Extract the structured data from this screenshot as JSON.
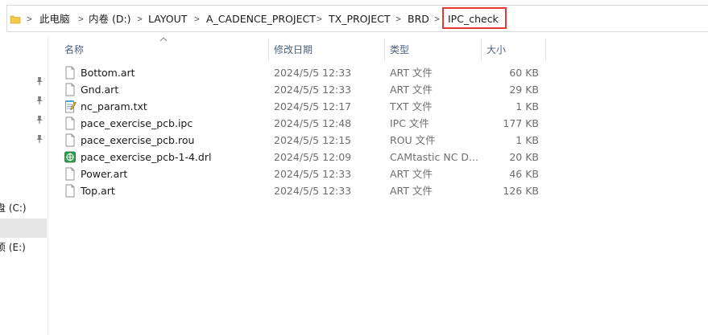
{
  "breadcrumb": [
    "此电脑",
    "内卷 (D:)",
    "LAYOUT",
    "A_CADENCE_PROJECT",
    "TX_PROJECT",
    "BRD",
    "IPC_check"
  ],
  "columns": {
    "name": "名称",
    "modified": "修改日期",
    "type": "类型",
    "size": "大小"
  },
  "files": [
    {
      "name": "Bottom.art",
      "modified": "2024/5/5 12:33",
      "type": "ART 文件",
      "size": "60 KB",
      "icon": "blank-file-icon"
    },
    {
      "name": "Gnd.art",
      "modified": "2024/5/5 12:33",
      "type": "ART 文件",
      "size": "29 KB",
      "icon": "blank-file-icon"
    },
    {
      "name": "nc_param.txt",
      "modified": "2024/5/5 12:17",
      "type": "TXT 文件",
      "size": "1 KB",
      "icon": "notepad-file-icon"
    },
    {
      "name": "pace_exercise_pcb.ipc",
      "modified": "2024/5/5 12:48",
      "type": "IPC 文件",
      "size": "177 KB",
      "icon": "blank-file-icon"
    },
    {
      "name": "pace_exercise_pcb.rou",
      "modified": "2024/5/5 12:15",
      "type": "ROU 文件",
      "size": "1 KB",
      "icon": "blank-file-icon"
    },
    {
      "name": "pace_exercise_pcb-1-4.drl",
      "modified": "2024/5/5 12:09",
      "type": "CAMtastic NC D...",
      "size": "20 KB",
      "icon": "camtastic-file-icon"
    },
    {
      "name": "Power.art",
      "modified": "2024/5/5 12:33",
      "type": "ART 文件",
      "size": "46 KB",
      "icon": "blank-file-icon"
    },
    {
      "name": "Top.art",
      "modified": "2024/5/5 12:33",
      "type": "ART 文件",
      "size": "126 KB",
      "icon": "blank-file-icon"
    }
  ],
  "sidebar": {
    "drives": [
      "盘 (C:)",
      ")",
      "项 (E:)",
      ")"
    ],
    "selected_index": 1
  },
  "colors": {
    "highlight_box": "#e53935",
    "header_text": "#4c607a",
    "selected_bg": "#e5e5e5"
  }
}
